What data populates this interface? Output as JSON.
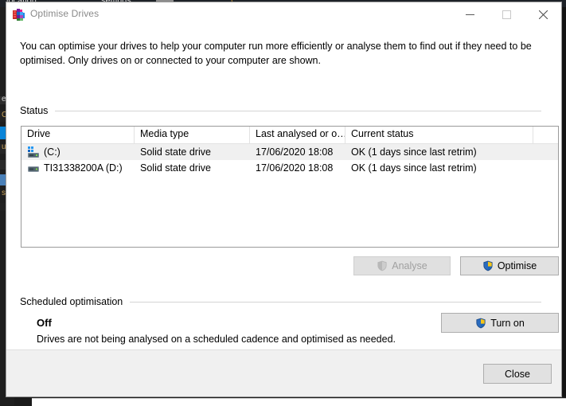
{
  "window": {
    "title": "Optimise Drives",
    "icon": "defrag-icon",
    "controls": {
      "minimise": "minimise-icon",
      "maximise": "maximise-icon",
      "close": "close-icon"
    }
  },
  "intro": {
    "text": "You can optimise your drives to help your computer run more efficiently or analyse them to find out if they need to be optimised. Only drives on or connected to your computer are shown."
  },
  "status_section": {
    "heading": "Status",
    "columns": [
      "Drive",
      "Media type",
      "Last analysed or o…",
      "Current status"
    ],
    "rows": [
      {
        "icon": "system-drive-icon",
        "drive": "(C:)",
        "media_type": "Solid state drive",
        "last_analysed": "17/06/2020 18:08",
        "current_status": "OK (1 days since last retrim)",
        "selected": true
      },
      {
        "icon": "drive-icon",
        "drive": "TI31338200A (D:)",
        "media_type": "Solid state drive",
        "last_analysed": "17/06/2020 18:08",
        "current_status": "OK (1 days since last retrim)",
        "selected": false
      }
    ],
    "buttons": {
      "analyse": "Analyse",
      "analyse_enabled": false,
      "optimise": "Optimise",
      "optimise_enabled": true
    }
  },
  "scheduled_section": {
    "heading": "Scheduled optimisation",
    "state": "Off",
    "description": "Drives are not being analysed on a scheduled cadence and optimised as needed.",
    "turn_on_button": "Turn on"
  },
  "footer": {
    "close_button": "Close"
  },
  "background": {
    "topbar_left_label": "location",
    "topbar_mid_label": "settings",
    "left_panel_labels": [
      "e",
      "C",
      "u",
      "s"
    ]
  },
  "colors": {
    "window_bg": "#ffffff",
    "footer_bg": "#f0f0f0",
    "border": "#9a9a9a",
    "title_text": "#8a8a8a",
    "row_selected": "#f0f0f0",
    "shield_blue": "#2a5fa5",
    "shield_gold": "#f0c020",
    "desktop": "#141414"
  }
}
